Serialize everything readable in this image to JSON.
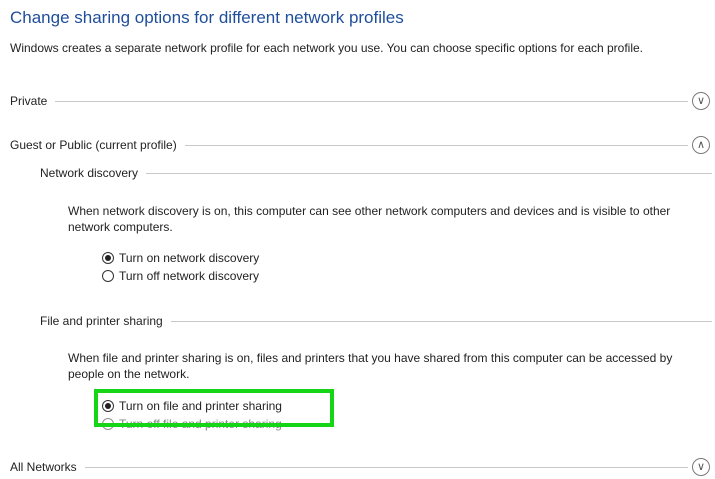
{
  "title": "Change sharing options for different network profiles",
  "description": "Windows creates a separate network profile for each network you use. You can choose specific options for each profile.",
  "profiles": {
    "private": {
      "label": "Private",
      "expanded": false,
      "icon": "chevron-down-icon"
    },
    "guest": {
      "label": "Guest or Public (current profile)",
      "expanded": true,
      "icon": "chevron-up-icon"
    },
    "all": {
      "label": "All Networks",
      "expanded": false,
      "icon": "chevron-down-icon"
    }
  },
  "network_discovery": {
    "header": "Network discovery",
    "text": "When network discovery is on, this computer can see other network computers and devices and is visible to other network computers.",
    "options": [
      {
        "label": "Turn on network discovery",
        "selected": true
      },
      {
        "label": "Turn off network discovery",
        "selected": false
      }
    ]
  },
  "file_sharing": {
    "header": "File and printer sharing",
    "text": "When file and printer sharing is on, files and printers that you have shared from this computer can be accessed by people on the network.",
    "options": [
      {
        "label": "Turn on file and printer sharing",
        "selected": true
      },
      {
        "label": "Turn off file and printer sharing",
        "selected": false
      }
    ]
  },
  "highlight_color": "#16d416",
  "title_color": "#1f4e9c"
}
